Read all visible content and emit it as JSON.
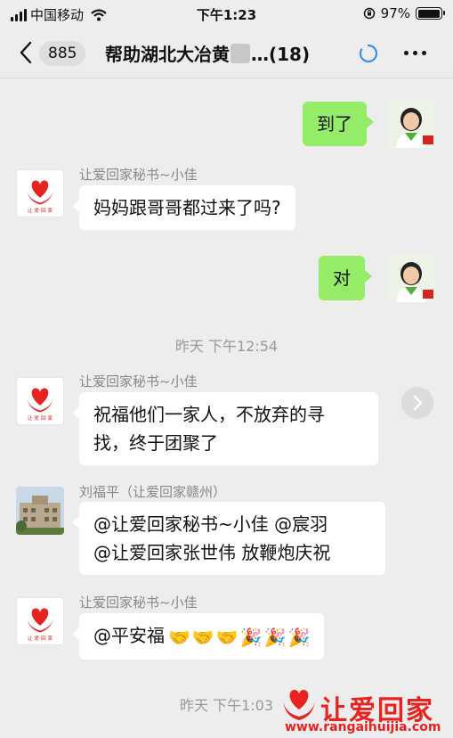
{
  "status_bar": {
    "carrier": "中国移动",
    "time": "下午1:23",
    "battery": "97%",
    "battery_level": 0.97
  },
  "nav": {
    "unread_count": "885",
    "title_prefix": "帮助湖北大冶黄",
    "title_suffix": "…(18)"
  },
  "messages": [
    {
      "side": "right",
      "text": "到了"
    },
    {
      "side": "left",
      "sender": "让爱回家秘书~小佳",
      "text": "妈妈跟哥哥都过来了吗?"
    },
    {
      "side": "right",
      "text": "对"
    },
    {
      "timestamp": "昨天 下午12:54"
    },
    {
      "side": "left",
      "sender": "让爱回家秘书~小佳",
      "text_line1": "祝福他们一家人，不放弃的寻",
      "text_line2": "找，终于团聚了"
    },
    {
      "side": "left",
      "sender": "刘福平（让爱回家赣州）",
      "text_line1": "@让爱回家秘书~小佳 @宸羽",
      "text_line2": "@让爱回家张世伟 放鞭炮庆祝"
    },
    {
      "side": "left",
      "sender": "让爱回家秘书~小佳",
      "text": "@平安福",
      "emoji": [
        "🤝",
        "🤝",
        "🤝",
        "🎉",
        "🎉",
        "🎉"
      ]
    },
    {
      "timestamp": "昨天 下午1:03"
    }
  ],
  "avatar_logo_text": "让 爱 回 家",
  "watermark": {
    "title": "让爱回家",
    "url": "www.rangaihuijia.com"
  },
  "colors": {
    "background": "#ededed",
    "bubble_self": "#95ec69",
    "bubble_other": "#ffffff",
    "logo_red": "#e8221f"
  }
}
